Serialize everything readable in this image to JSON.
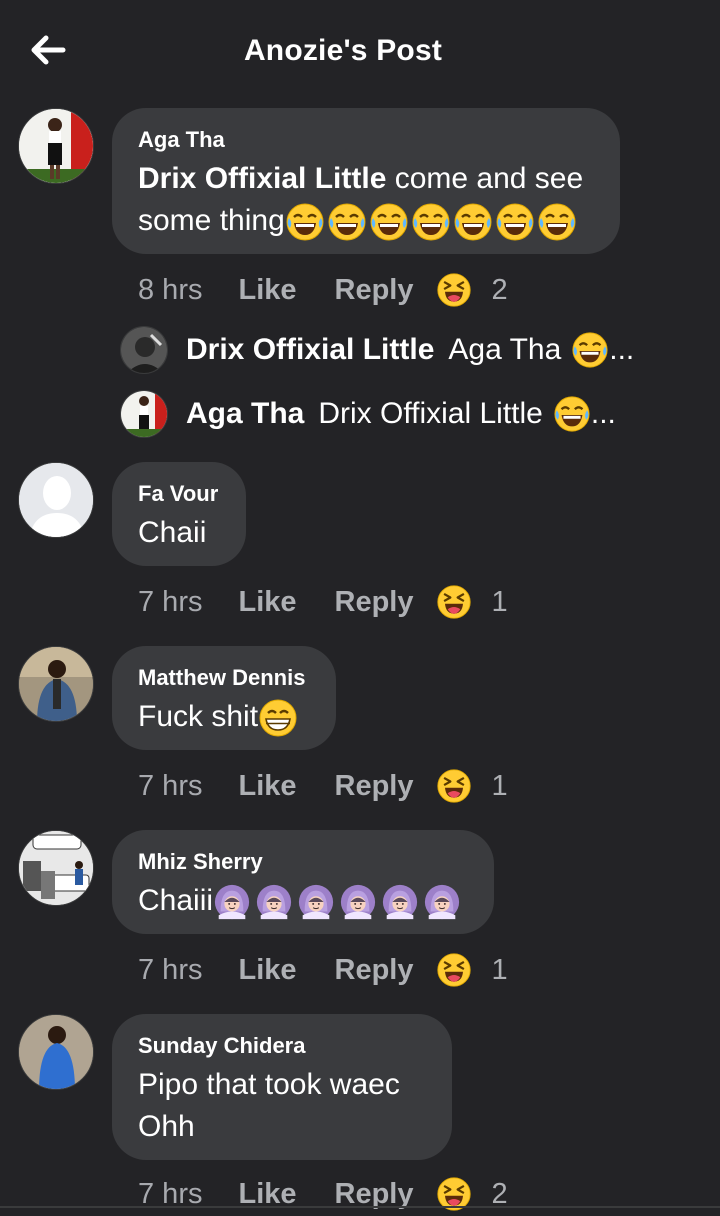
{
  "header": {
    "title": "Anozie's Post",
    "back_icon": "arrow-left-icon"
  },
  "comments": [
    {
      "author": "Aga Tha",
      "mention": "Drix Offixial Little",
      "text": " come and see some thing",
      "emoji_count": 7,
      "emoji": "tears-of-joy",
      "time": "8 hrs",
      "like": "Like",
      "reply": "Reply",
      "reactions": "2",
      "replies": [
        {
          "author": "Drix Offixial Little",
          "text": "Aga Tha",
          "ellipsis": "..."
        },
        {
          "author": "Aga Tha",
          "text": "Drix Offixial Little",
          "ellipsis": "..."
        }
      ]
    },
    {
      "author": "Fa Vour",
      "text": "Chaii",
      "time": "7 hrs",
      "like": "Like",
      "reply": "Reply",
      "reactions": "1"
    },
    {
      "author": "Matthew Dennis",
      "text": "Fuck shit",
      "emoji": "grinning",
      "time": "7 hrs",
      "like": "Like",
      "reply": "Reply",
      "reactions": "1"
    },
    {
      "author": "Mhiz Sherry",
      "text": "Chaiii",
      "emoji": "person-ok-gesture",
      "emoji_count": 6,
      "time": "7 hrs",
      "like": "Like",
      "reply": "Reply",
      "reactions": "1"
    },
    {
      "author": "Sunday Chidera",
      "text_line1": "Pipo that took waec",
      "text_line2": "Ohh",
      "time": "7 hrs",
      "like": "Like",
      "reply": "Reply",
      "reactions": "2"
    }
  ],
  "colors": {
    "background": "#232326",
    "bubble": "#3a3b3e",
    "muted": "#aeb0b4",
    "emoji_yellow": "#ffcc33"
  }
}
